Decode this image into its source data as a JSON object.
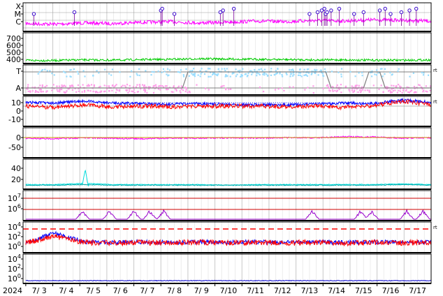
{
  "chart_data": {
    "type": "line",
    "x_axis": {
      "year_label": "2024",
      "tick_labels": [
        "7/ 3",
        "7/ 4",
        "7/ 5",
        "7/ 6",
        "7/ 7",
        "7/ 8",
        "7/ 9",
        "7/10",
        "7/11",
        "7/12",
        "7/13",
        "7/14",
        "7/15",
        "7/16",
        "7/17"
      ],
      "grid": true
    },
    "panels": [
      {
        "id": "xray-class",
        "y_tick_labels": [
          "X",
          "M",
          "C"
        ],
        "series": [
          {
            "color": "#ff00ff",
            "style": "line",
            "profile": [
              0.35,
              0.3,
              0.4,
              0.35,
              0.45,
              0.5,
              0.4,
              0.45,
              0.55,
              0.5,
              0.6,
              0.55,
              0.65,
              0.6,
              0.55
            ]
          }
        ],
        "flare_marker_days": [
          0.3,
          1.8,
          5.0,
          5.05,
          5.5,
          7.2,
          7.3,
          7.7,
          10.5,
          10.8,
          10.95,
          11.05,
          11.1,
          11.15,
          11.3,
          11.6,
          12.15,
          12.5,
          13.1,
          13.3,
          13.5,
          13.9,
          14.2,
          14.45
        ]
      },
      {
        "id": "solar-wind-speed",
        "y_tick_labels": [
          "700",
          "600",
          "500",
          "400"
        ],
        "right_label": "",
        "series": [
          {
            "color": "#00cc00",
            "style": "line",
            "profile": [
              380,
              380,
              390,
              385,
              395,
              400,
              410,
              405,
              400,
              395,
              390,
              390,
              385,
              385,
              390
            ]
          }
        ]
      },
      {
        "id": "imf-sector",
        "y_tick_labels": [
          "T",
          "A"
        ],
        "right_label": "rt",
        "series": [
          {
            "color": "#ff9ee8",
            "style": "scatter-band",
            "level": "A"
          },
          {
            "color": "#99ddff",
            "style": "scatter-band",
            "level": "T"
          },
          {
            "color": "#808080",
            "style": "step",
            "steps": [
              [
                0,
                "A"
              ],
              [
                5.8,
                "A"
              ],
              [
                6.0,
                "T"
              ],
              [
                11.1,
                "T"
              ],
              [
                11.3,
                "A"
              ],
              [
                12.5,
                "A"
              ],
              [
                12.7,
                "T"
              ],
              [
                13.1,
                "T"
              ],
              [
                13.3,
                "A"
              ],
              [
                15,
                "A"
              ]
            ]
          }
        ]
      },
      {
        "id": "imf-components",
        "y_tick_labels": [
          "10",
          "0",
          "-10"
        ],
        "right_label": "rt",
        "series": [
          {
            "color": "#0000ff",
            "style": "line",
            "profile": [
              6,
              5,
              8,
              5,
              4,
              3,
              4,
              3,
              2,
              2,
              3,
              5,
              4,
              10,
              6
            ]
          },
          {
            "color": "#ff0000",
            "style": "line",
            "profile": [
              0,
              -2,
              2,
              -1,
              0,
              -1,
              0,
              0,
              0,
              -1,
              0,
              -2,
              1,
              8,
              2
            ]
          },
          {
            "color": "#0000ff",
            "style": "dotted",
            "profile": [
              4,
              4,
              4,
              3,
              3,
              3,
              3,
              3,
              3,
              3,
              3,
              3,
              3,
              4,
              4
            ]
          }
        ]
      },
      {
        "id": "dst",
        "y_tick_labels": [
          "0",
          "-50"
        ],
        "series": [
          {
            "color": "#ff00ff",
            "style": "line",
            "profile": [
              -5,
              -8,
              -2,
              -5,
              -8,
              -3,
              -4,
              -2,
              -3,
              -1,
              -2,
              5,
              3,
              -4,
              -2
            ]
          },
          {
            "color": "#cc9900",
            "style": "hline",
            "value": 0
          }
        ]
      },
      {
        "id": "proton-flux",
        "y_tick_labels": [
          "40",
          "20"
        ],
        "series": [
          {
            "color": "#00dddd",
            "style": "line",
            "profile": [
              4,
              4,
              6,
              4,
              4,
              4,
              4,
              3,
              4,
              4,
              4,
              4,
              4,
              5,
              4
            ]
          },
          {
            "color": "#00aaaa",
            "style": "line",
            "profile": [
              3,
              3,
              4,
              3,
              3,
              3,
              3,
              3,
              3,
              3,
              3,
              3,
              3,
              4,
              3
            ]
          }
        ],
        "spike": {
          "day": 2.2,
          "value": 28
        }
      },
      {
        "id": "electron-flux",
        "y_tick_labels": [
          "10^7",
          "10^6"
        ],
        "series": [
          {
            "color": "#9900cc",
            "style": "line",
            "bumps": [
              2.1,
              3.1,
              4.0,
              4.6,
              5.1,
              10.6,
              12.4,
              12.8,
              14.1,
              14.7
            ]
          },
          {
            "color": "#cc0000",
            "style": "hline",
            "level": "10^7"
          },
          {
            "color": "#cc0000",
            "style": "hline",
            "level": "10^6"
          }
        ]
      },
      {
        "id": "xray-flux",
        "y_tick_labels": [
          "10^4",
          "10^2",
          "10^0"
        ],
        "right_label": "rt",
        "series": [
          {
            "color": "#0000ff",
            "style": "line",
            "profile": [
              1.6,
              3.5,
              1.8,
              1.7,
              1.8,
              1.7,
              1.8,
              1.7,
              1.8,
              1.7,
              1.8,
              1.7,
              1.8,
              1.7,
              1.8
            ]
          },
          {
            "color": "#ff0000",
            "style": "line",
            "profile": [
              1.6,
              2.8,
              1.7,
              1.6,
              1.7,
              1.6,
              1.7,
              1.6,
              1.7,
              1.6,
              1.7,
              1.6,
              1.7,
              1.6,
              1.7
            ]
          },
          {
            "color": "#ff0000",
            "style": "dashed-hline",
            "level": "10^4"
          }
        ]
      },
      {
        "id": "neutron",
        "y_tick_labels": [
          "10^4",
          "10^2",
          "10^0"
        ],
        "series": [
          {
            "color": "#0000cc",
            "style": "line",
            "profile": [
              -0.8,
              -0.8,
              -0.8,
              -0.8,
              -0.8,
              -0.8,
              -0.8,
              -0.8,
              -0.8,
              -0.8,
              -0.8,
              -0.8,
              -0.8,
              -0.8,
              -0.8
            ]
          }
        ]
      }
    ]
  }
}
